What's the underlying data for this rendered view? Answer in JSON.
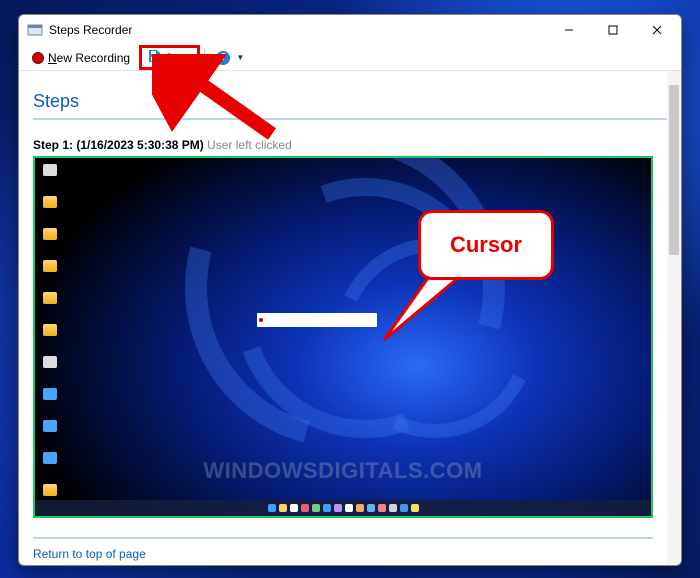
{
  "window": {
    "title": "Steps Recorder"
  },
  "toolbar": {
    "new_recording_label": "New Recording",
    "save_label": "Save",
    "help_symbol": "?"
  },
  "section": {
    "heading": "Steps"
  },
  "step": {
    "prefix": "Step 1: ",
    "timestamp": "(1/16/2023 5:30:38 PM)",
    "action": " User left clicked"
  },
  "callout": {
    "text": "Cursor"
  },
  "watermark": "WINDOWSDIGITALS.COM",
  "return_link": "Return to top of page",
  "annotation": {
    "highlight_target": "save-button",
    "arrow_points_to": "save-button"
  }
}
